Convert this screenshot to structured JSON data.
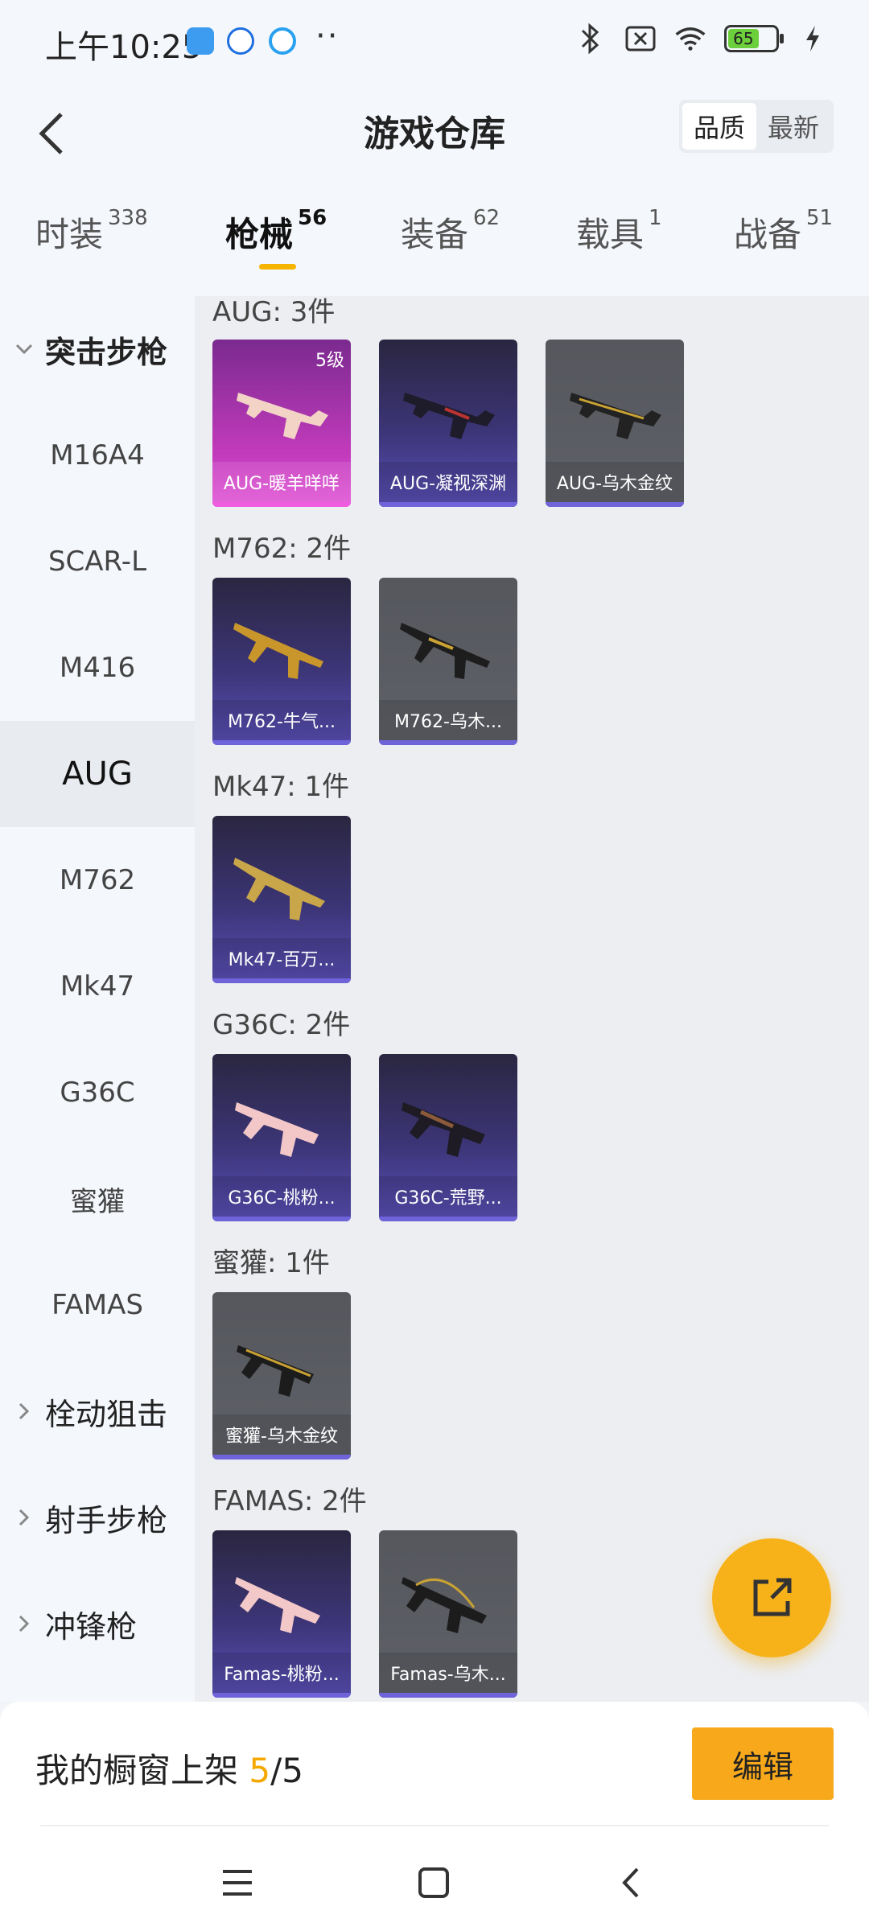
{
  "status": {
    "time": "上午10:25",
    "battery": "65"
  },
  "header": {
    "title": "游戏仓库",
    "sort": [
      "品质",
      "最新"
    ]
  },
  "tabs": [
    {
      "label": "时装",
      "count": "338"
    },
    {
      "label": "枪械",
      "count": "56"
    },
    {
      "label": "装备",
      "count": "62"
    },
    {
      "label": "载具",
      "count": "1"
    },
    {
      "label": "战备",
      "count": "51"
    }
  ],
  "sidebar": {
    "group_expanded": "突击步枪",
    "items": [
      "M16A4",
      "SCAR-L",
      "M416",
      "AUG",
      "M762",
      "Mk47",
      "G36C",
      "蜜獾",
      "FAMAS"
    ],
    "groups_collapsed": [
      "栓动狙击",
      "射手步枪",
      "冲锋枪"
    ]
  },
  "sections": [
    {
      "title": "AUG: 3件",
      "items": [
        {
          "label": "AUG-暖羊咩咩",
          "badge": "5级",
          "rarity": "pink"
        },
        {
          "label": "AUG-凝视深渊",
          "rarity": "purple"
        },
        {
          "label": "AUG-乌木金纹",
          "rarity": "gray"
        }
      ]
    },
    {
      "title": "M762: 2件",
      "items": [
        {
          "label": "M762-牛气...",
          "rarity": "purple"
        },
        {
          "label": "M762-乌木...",
          "rarity": "gray"
        }
      ]
    },
    {
      "title": "Mk47: 1件",
      "items": [
        {
          "label": "Mk47-百万...",
          "rarity": "purple"
        }
      ]
    },
    {
      "title": "G36C: 2件",
      "items": [
        {
          "label": "G36C-桃粉...",
          "rarity": "purple"
        },
        {
          "label": "G36C-荒野...",
          "rarity": "purple"
        }
      ]
    },
    {
      "title": "蜜獾: 1件",
      "items": [
        {
          "label": "蜜獾-乌木金纹",
          "rarity": "gray"
        }
      ]
    },
    {
      "title": "FAMAS: 2件",
      "items": [
        {
          "label": "Famas-桃粉...",
          "rarity": "purple"
        },
        {
          "label": "Famas-乌木...",
          "rarity": "gray"
        }
      ]
    }
  ],
  "bottom": {
    "shelf_label": "我的橱窗上架",
    "shelf_current": "5",
    "shelf_total": "/5",
    "edit_label": "编辑"
  }
}
